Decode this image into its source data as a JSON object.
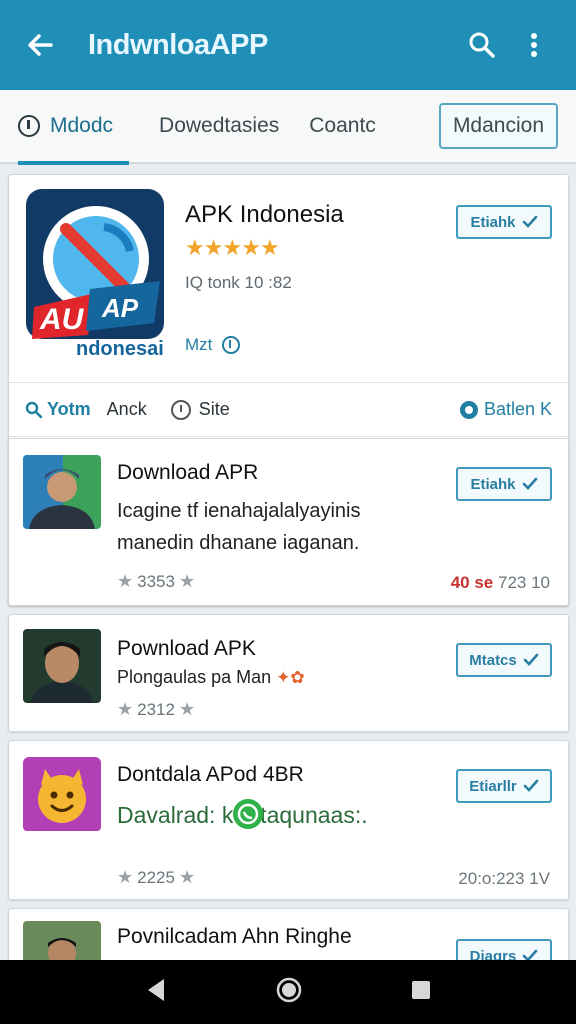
{
  "appbar": {
    "title": "IndwnloaAPP"
  },
  "tabs": [
    {
      "label": "Mdodc"
    },
    {
      "label": "Dowedtasies"
    },
    {
      "label": "Coantc"
    },
    {
      "label": "Mdancion"
    }
  ],
  "hero": {
    "name": "APK Indonesia",
    "rating_stars": 5,
    "meta": "IQ tonk 10 :82",
    "sub": "Mzt",
    "install_label": "Etiahk",
    "logo_text_red": "AU",
    "logo_text_blue": "AP",
    "logo_caption": "ndonesai",
    "row": {
      "search_link": "Yotm",
      "middle": "Anck",
      "clock_label": "Site",
      "right_link": "Batlen K"
    }
  },
  "items": [
    {
      "title": "Download APR",
      "desc": "Icagine tf ienahajalalyayinis manedin dhanane iaganan.",
      "rating": "3353",
      "right_red": "40 se",
      "right_gray": "723 10",
      "install_label": "Etiahk"
    },
    {
      "title": "Pownload APK",
      "desc": "Plongaulas pa Man",
      "rating": "2312",
      "install_label": "Mtatcs"
    },
    {
      "title": "Dontdala APod 4BR",
      "desc": "Davalrad: k Aftaqunaas:.",
      "rating": "2225",
      "right_gray": "20:o:223 1V",
      "install_label": "Etiarllr"
    },
    {
      "title": "Povnilcadam Ahn Ringhe",
      "install_label": "Diagrs"
    }
  ],
  "colors": {
    "primary": "#1f8fb8",
    "accent_red": "#c6322f",
    "star": "#f2a52a"
  }
}
